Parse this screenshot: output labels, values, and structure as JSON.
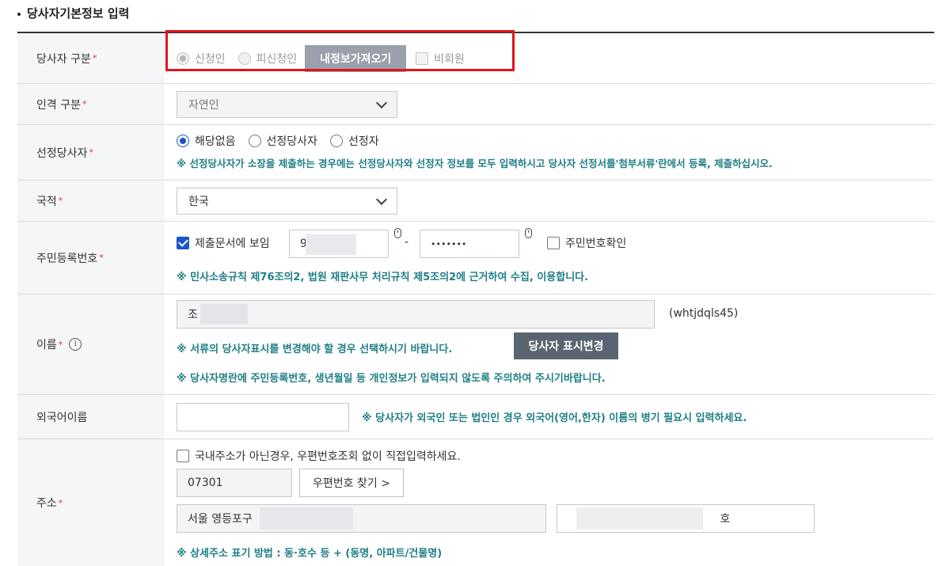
{
  "section_title": "당사자기본정보 입력",
  "required_mark": "*",
  "rows": {
    "party_type": {
      "label": "당사자 구분",
      "options": [
        "신청인",
        "피신청인"
      ],
      "button": "내정보가져오기",
      "checkbox": "비회원"
    },
    "person_type": {
      "label": "인격 구분",
      "value": "자연인"
    },
    "selected_party": {
      "label": "선정당사자",
      "options": [
        "해당없음",
        "선정당사자",
        "선정자"
      ],
      "note": "※ 선정당사자가 소장을 제출하는 경우에는 선정당사자와 선정자 정보를 모두 입력하시고 당사자 선정서를'첨부서류'란에서 등록, 제출하십시오."
    },
    "nationality": {
      "label": "국적",
      "value": "한국"
    },
    "resident_id": {
      "label": "주민등록번호",
      "show_in_doc": "제출문서에 보임",
      "front_value": "9",
      "dash": "-",
      "back_value": "•••••••",
      "verify": "주민번호확인",
      "note": "※ 민사소송규칙 제76조의2, 법원 재판사무 처리규칙 제5조의2에 근거하여 수집, 이용합니다."
    },
    "name": {
      "label": "이름",
      "info_icon": "i",
      "value": "조",
      "user_id": "(whtjdqls45)",
      "note1": "※ 서류의 당사자표시를 변경해야 할 경우 선택하시기 바랍니다.",
      "change_button": "당사자 표시변경",
      "note2": "※ 당사자명란에 주민등록번호, 생년월일 등 개인정보가 입력되지 않도록 주의하여 주시기바랍니다."
    },
    "foreign_name": {
      "label": "외국어이름",
      "value": "",
      "note": "※ 당사자가 외국인 또는 법인인 경우 외국어(영어,한자) 이름의 병기 필요시 입력하세요."
    },
    "address": {
      "label": "주소",
      "non_domestic": "국내주소가 아닌경우, 우편번호조회 없이 직접입력하세요.",
      "postcode": "07301",
      "find_button": "우편번호 찾기 >",
      "address1": "서울 영등포구",
      "address2": "호",
      "note": "※ 상세주소 표기 방법 : 동·호수 등 + (동명, 아파트/건물명)"
    }
  }
}
